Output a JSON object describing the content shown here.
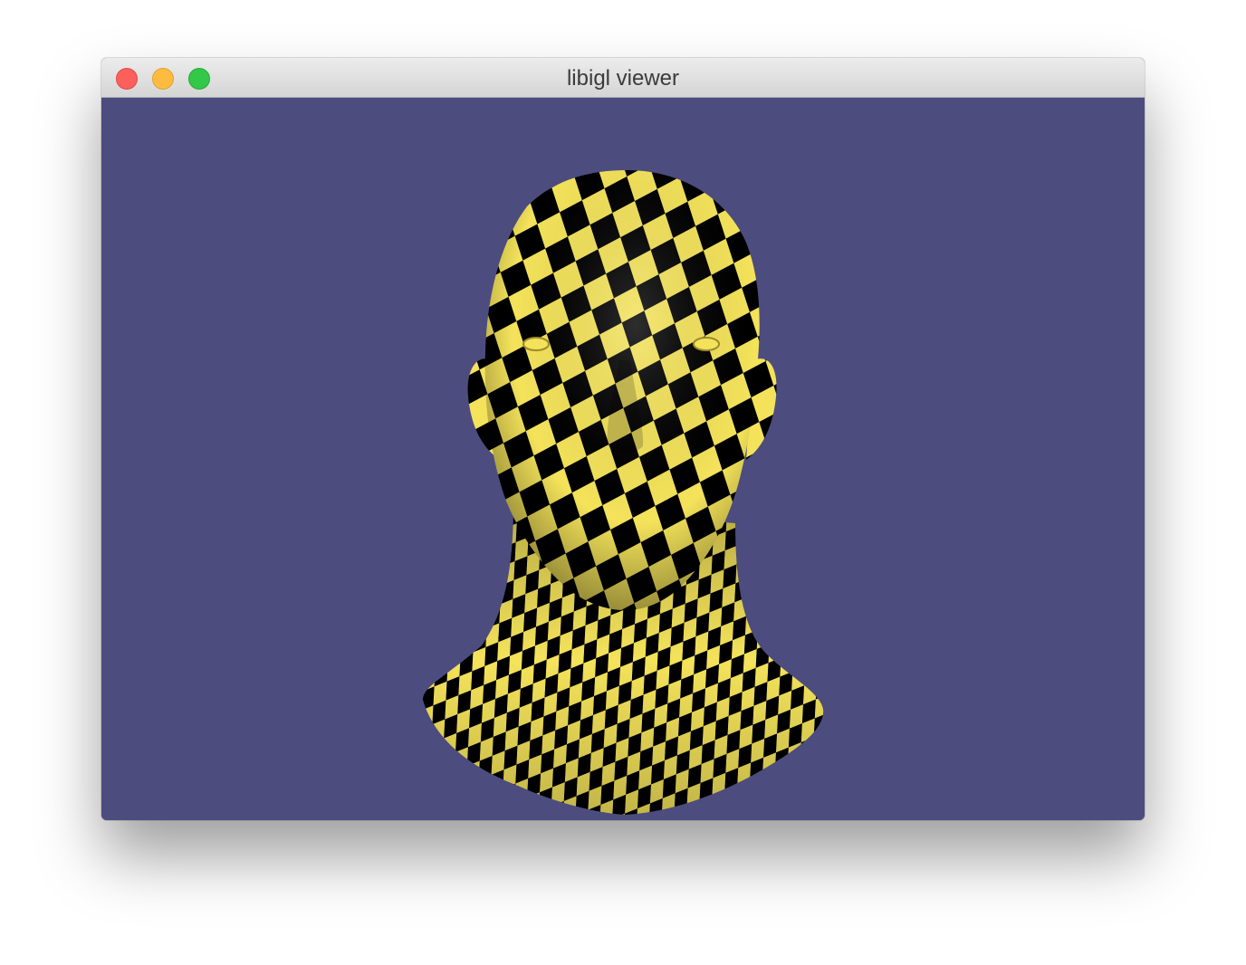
{
  "window": {
    "title": "libigl viewer",
    "buttons": [
      "close",
      "minimize",
      "zoom"
    ]
  },
  "viewport": {
    "background_color": "#4d4c7f",
    "content": "head-mesh",
    "texture": "checkerboard",
    "texture_colors": [
      "#f4e35a",
      "#000000"
    ]
  }
}
